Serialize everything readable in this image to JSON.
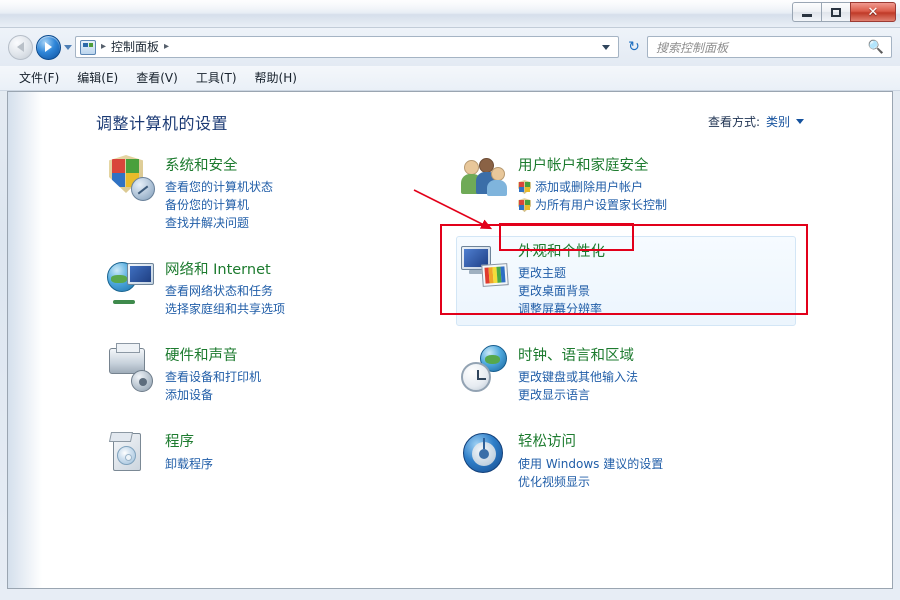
{
  "window": {
    "title": "",
    "buttons": {
      "minimize": "minimize-button",
      "maximize": "maximize-button",
      "close": "✕"
    }
  },
  "navbar": {
    "back_label": "后退",
    "forward_label": "前进",
    "breadcrumb_icon": "control-panel-icon",
    "breadcrumb": "控制面板",
    "separator": "▸",
    "refresh": "↻",
    "search_placeholder": "搜索控制面板",
    "search_value": "",
    "search_icon": "search-icon"
  },
  "menubar": {
    "items": [
      {
        "label": "文件(F)"
      },
      {
        "label": "编辑(E)"
      },
      {
        "label": "查看(V)"
      },
      {
        "label": "工具(T)"
      },
      {
        "label": "帮助(H)"
      }
    ]
  },
  "page": {
    "title": "调整计算机的设置",
    "view_by_label": "查看方式:",
    "view_by_value": "类别"
  },
  "categories_left": [
    {
      "icon": "security-shield-icon",
      "title": "系统和安全",
      "links": [
        "查看您的计算机状态",
        "备份您的计算机",
        "查找并解决问题"
      ]
    },
    {
      "icon": "network-globe-icon",
      "title": "网络和 Internet",
      "links": [
        "查看网络状态和任务",
        "选择家庭组和共享选项"
      ]
    },
    {
      "icon": "printer-hardware-icon",
      "title": "硬件和声音",
      "links": [
        "查看设备和打印机",
        "添加设备"
      ]
    },
    {
      "icon": "programs-box-icon",
      "title": "程序",
      "links": [
        "卸载程序"
      ]
    }
  ],
  "categories_right": [
    {
      "icon": "user-accounts-icon",
      "title": "用户帐户和家庭安全",
      "links": [
        "添加或删除用户帐户",
        "为所有用户设置家长控制"
      ],
      "link_badges": true
    },
    {
      "icon": "appearance-display-icon",
      "title": "外观和个性化",
      "links": [
        "更改主题",
        "更改桌面背景",
        "调整屏幕分辨率"
      ],
      "highlighted": true
    },
    {
      "icon": "clock-region-icon",
      "title": "时钟、语言和区域",
      "links": [
        "更改键盘或其他输入法",
        "更改显示语言"
      ]
    },
    {
      "icon": "ease-of-access-icon",
      "title": "轻松访问",
      "links": [
        "使用 Windows 建议的设置",
        "优化视频显示"
      ]
    }
  ],
  "annotations": {
    "color": "#e2001a",
    "arrow_target": "外观和个性化",
    "boxes": [
      "appearance-section-box",
      "appearance-title-box"
    ]
  },
  "colors": {
    "category_title": "#1d7b2f",
    "link": "#215ea8",
    "page_title": "#1b3a74",
    "annotation_red": "#e2001a"
  }
}
